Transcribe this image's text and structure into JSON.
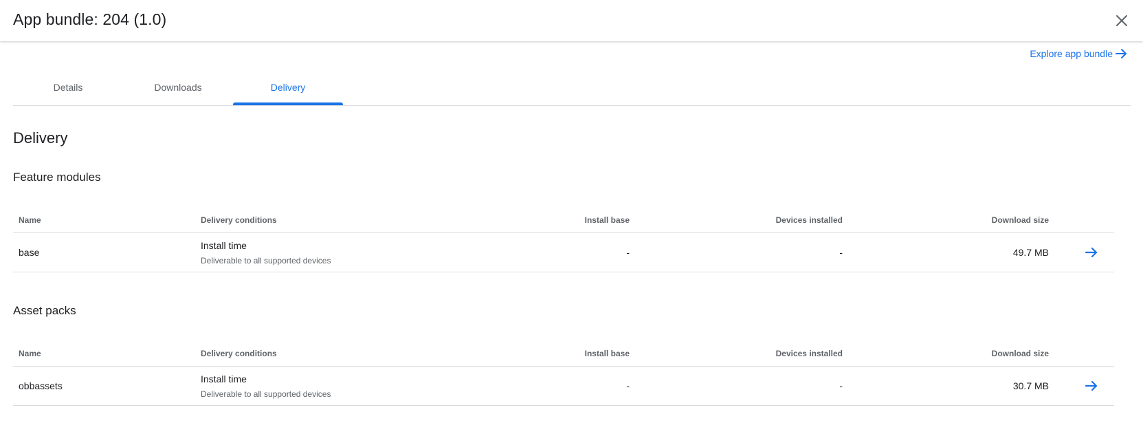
{
  "dialog": {
    "title": "App bundle: 204 (1.0)",
    "close_icon": "close-icon"
  },
  "explore_link": {
    "label": "Explore app bundle",
    "icon": "arrow-right-icon"
  },
  "tabs": [
    {
      "label": "Details",
      "active": false
    },
    {
      "label": "Downloads",
      "active": false
    },
    {
      "label": "Delivery",
      "active": true
    }
  ],
  "page_title": "Delivery",
  "accent_color": "#1a73e8",
  "feature_modules": {
    "title": "Feature modules",
    "columns": [
      "Name",
      "Delivery conditions",
      "Install base",
      "Devices installed",
      "Download size"
    ],
    "rows": [
      {
        "name": "base",
        "condition": "Install time",
        "condition_detail": "Deliverable to all supported devices",
        "install_base": "-",
        "devices_installed": "-",
        "download_size": "49.7 MB"
      }
    ]
  },
  "asset_packs": {
    "title": "Asset packs",
    "columns": [
      "Name",
      "Delivery conditions",
      "Install base",
      "Devices installed",
      "Download size"
    ],
    "rows": [
      {
        "name": "obbassets",
        "condition": "Install time",
        "condition_detail": "Deliverable to all supported devices",
        "install_base": "-",
        "devices_installed": "-",
        "download_size": "30.7 MB"
      }
    ]
  }
}
